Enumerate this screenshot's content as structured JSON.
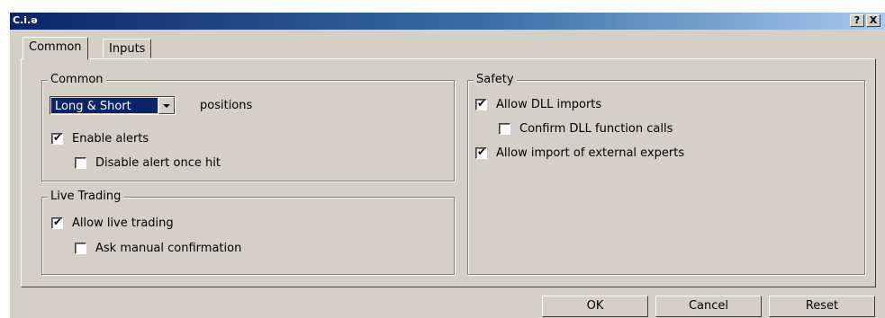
{
  "window": {
    "title": "C.i.ə"
  },
  "titlebar_buttons": {
    "help": "?",
    "close": "X"
  },
  "tabs": [
    {
      "label": "Common",
      "active": true
    },
    {
      "label": "Inputs",
      "active": false
    }
  ],
  "common": {
    "legend": "Common",
    "position_select": {
      "value": "Long & Short"
    },
    "positions_label": "positions",
    "enable_alerts": {
      "label": "Enable alerts",
      "checked": true
    },
    "disable_alert_once_hit": {
      "label": "Disable alert once hit",
      "checked": false
    }
  },
  "live_trading": {
    "legend": "Live Trading",
    "allow_live_trading": {
      "label": "Allow live trading",
      "checked": true
    },
    "ask_manual_confirmation": {
      "label": "Ask manual confirmation",
      "checked": false
    }
  },
  "safety": {
    "legend": "Safety",
    "allow_dll_imports": {
      "label": "Allow DLL imports",
      "checked": true
    },
    "confirm_dll_calls": {
      "label": "Confirm DLL function calls",
      "checked": false
    },
    "allow_external_experts": {
      "label": "Allow import of external experts",
      "checked": true
    }
  },
  "buttons": {
    "ok": "OK",
    "cancel": "Cancel",
    "reset": "Reset"
  },
  "colors": {
    "face": "#d4d0c8",
    "title_start": "#0a246a",
    "title_end": "#a6caf0",
    "selection": "#0a246a"
  },
  "check_glyph": "✔"
}
